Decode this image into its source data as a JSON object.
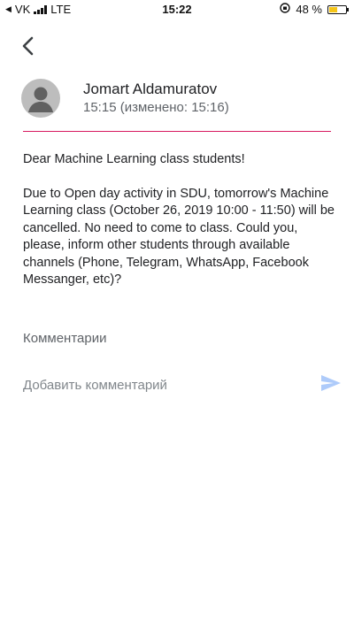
{
  "status_bar": {
    "carrier": "VK",
    "network": "LTE",
    "time": "15:22",
    "battery_percent": "48 %",
    "battery_level": 0.48,
    "battery_color": "#f5c518"
  },
  "post": {
    "author": "Jomart Aldamuratov",
    "time": "15:15 (изменено: 15:16)",
    "greeting": "Dear Machine Learning class students!",
    "body": "Due to Open day activity in SDU, tomorrow's Machine Learning class (October 26, 2019 10:00 - 11:50) will be cancelled. No need to come to class. Could you, please, inform other students through available channels (Phone, Telegram, WhatsApp, Facebook Messanger, etc)?"
  },
  "comments": {
    "heading": "Комментарии",
    "placeholder": "Добавить комментарий"
  },
  "colors": {
    "accent_divider": "#d81b60",
    "send_icon": "#aecbfa"
  },
  "icons": {
    "back": "chevron-left-icon",
    "avatar": "person-icon",
    "send": "send-icon",
    "orientation_lock": "orientation-lock-icon"
  }
}
